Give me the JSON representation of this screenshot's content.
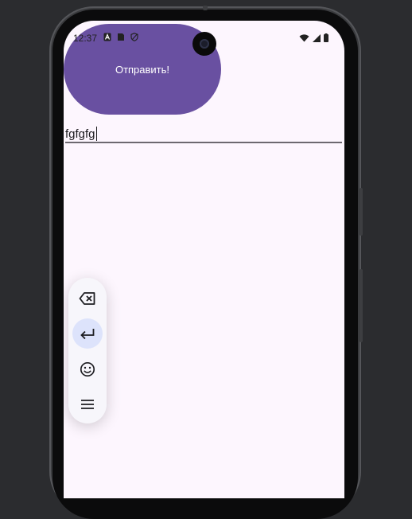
{
  "status_bar": {
    "time": "12:37"
  },
  "main": {
    "send_button_label": "Отправить!",
    "text_field_value": "fgfgfg"
  },
  "floating_toolbar": {
    "items": [
      "backspace-icon",
      "enter-icon",
      "emoji-icon",
      "menu-icon"
    ],
    "active_item": "enter-icon"
  },
  "colors": {
    "background": "#fdf6fe",
    "button": "#6950a1",
    "toolbar_active": "#dde3fb"
  }
}
